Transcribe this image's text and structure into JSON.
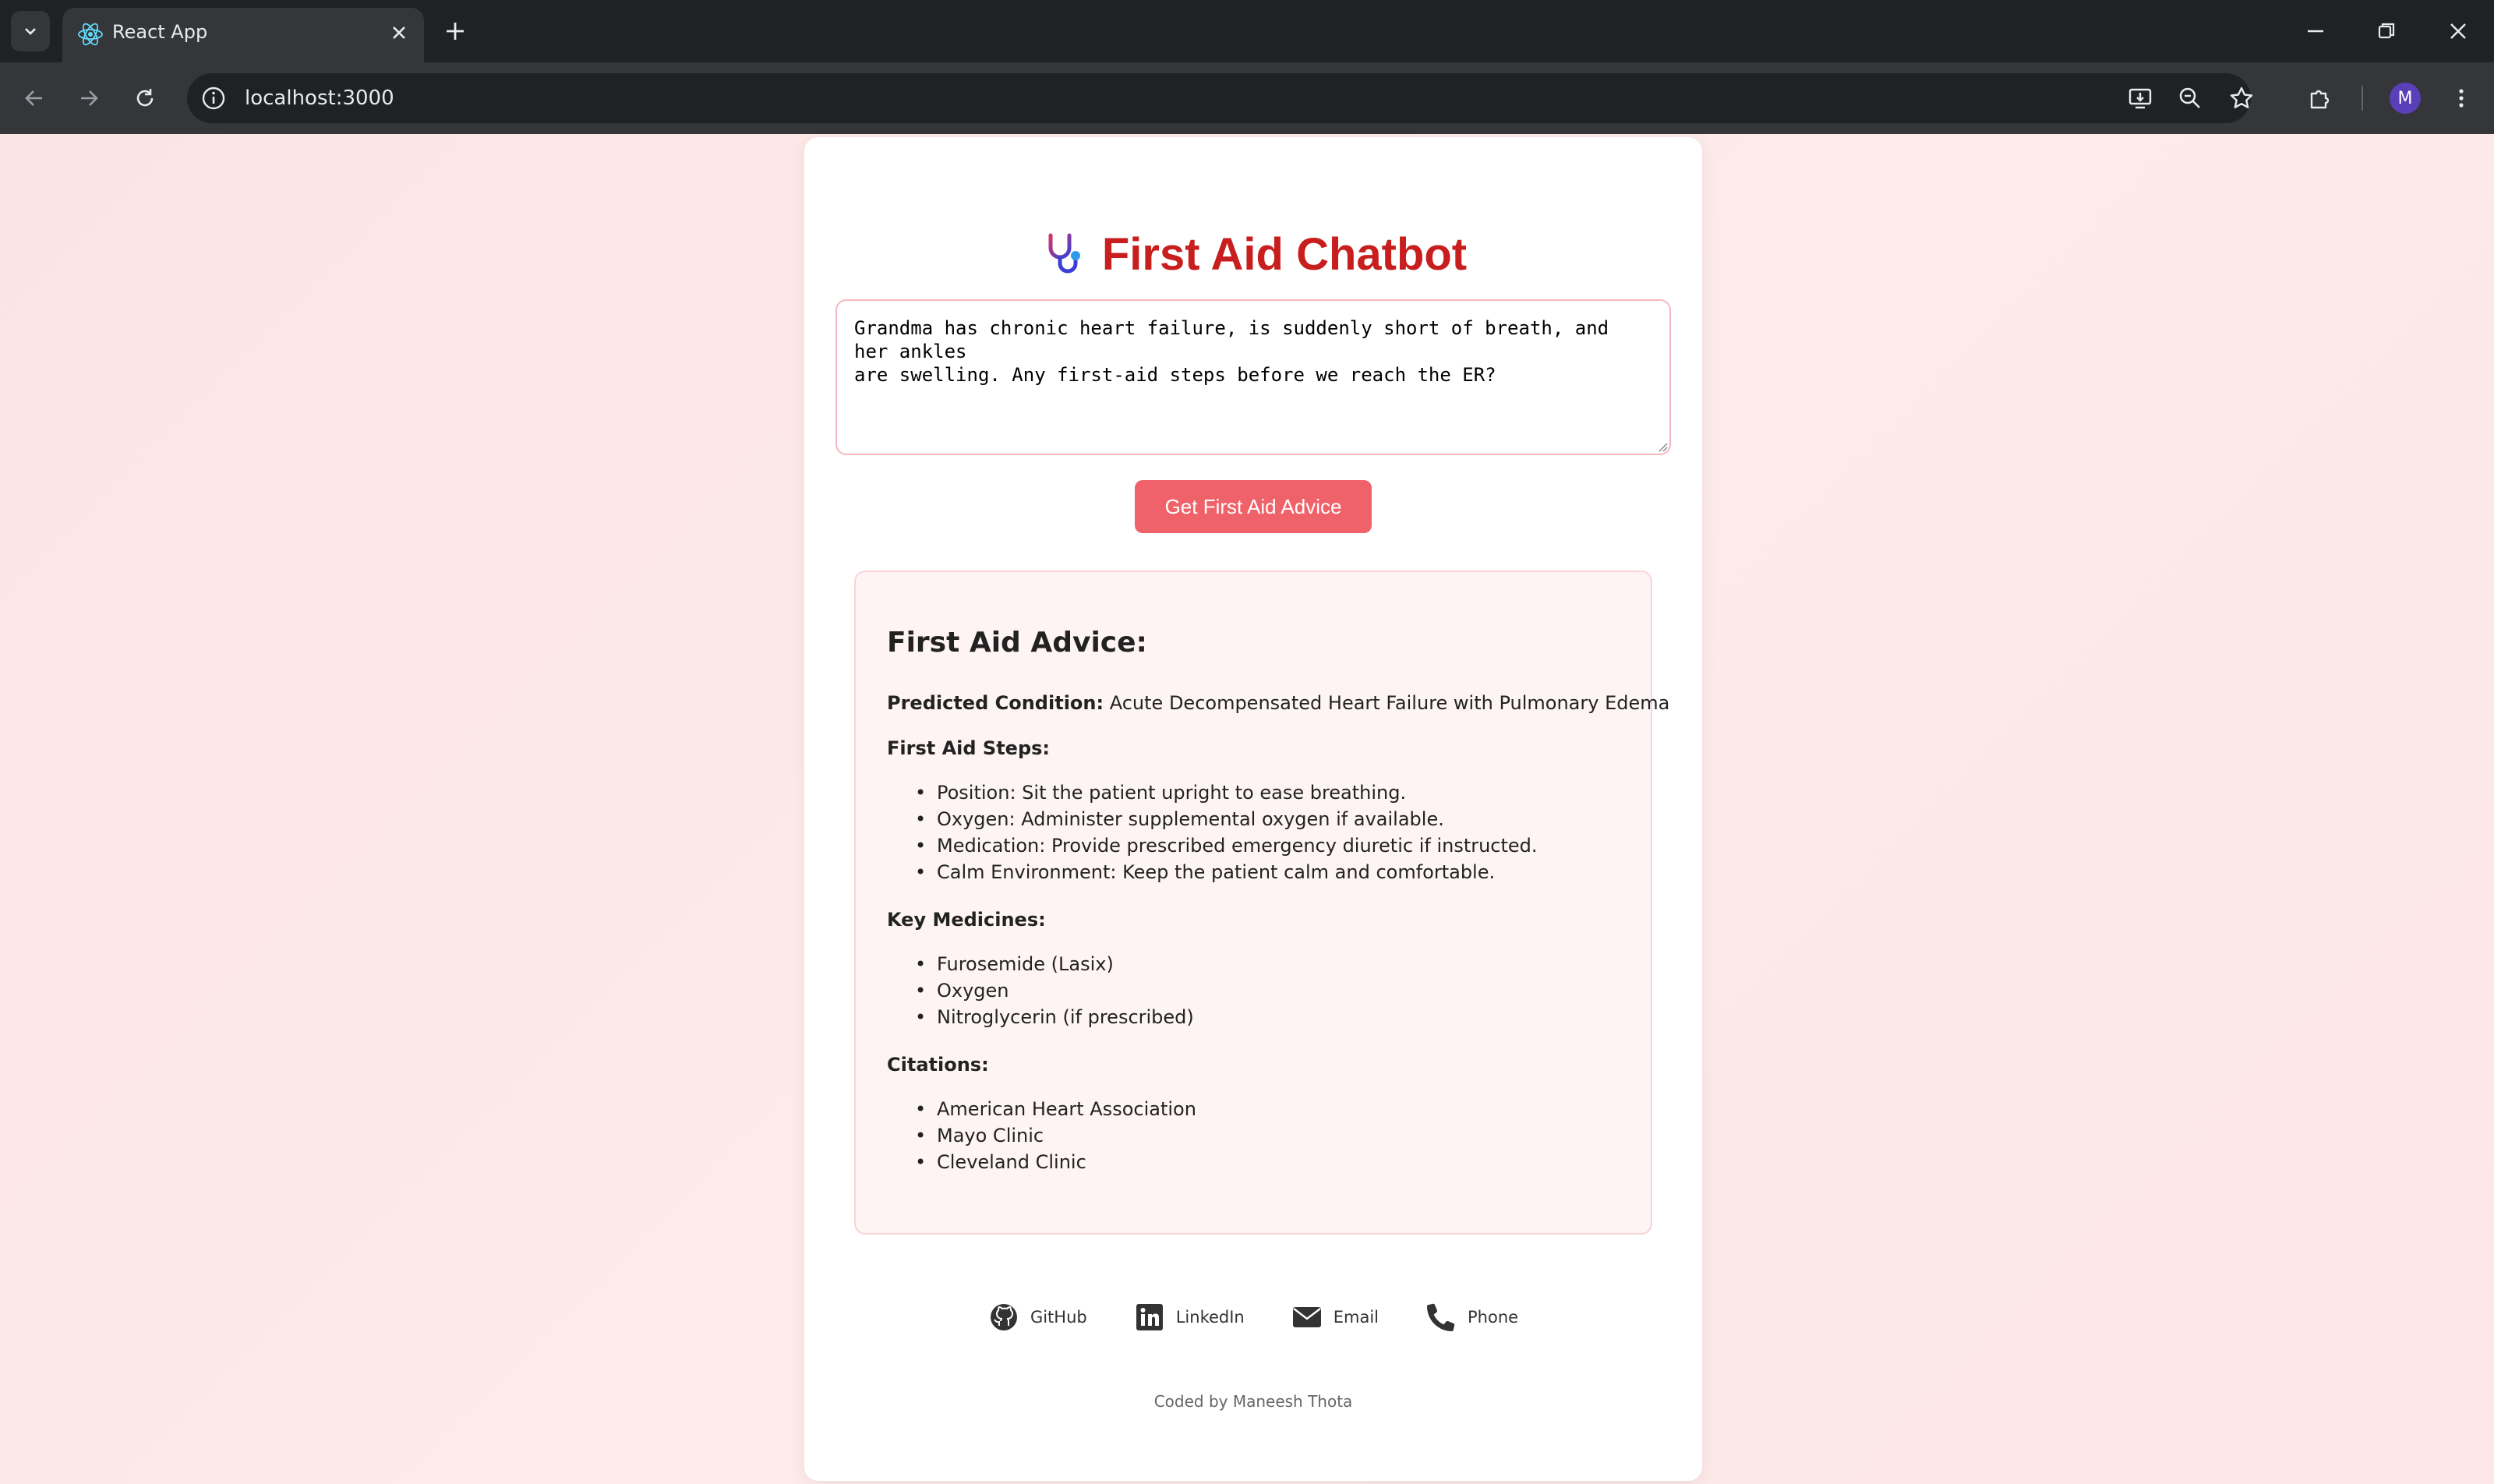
{
  "browser": {
    "tab_title": "React App",
    "url": "localhost:3000",
    "profile_initial": "M"
  },
  "app": {
    "title": "First Aid Chatbot",
    "query_text": "Grandma has chronic heart failure, is suddenly short of breath, and her ankles\nare swelling. Any first-aid steps before we reach the ER?",
    "submit_label": "Get First Aid Advice"
  },
  "advice": {
    "heading": "First Aid Advice:",
    "condition_label": "Predicted Condition:",
    "condition_value": "Acute Decompensated Heart Failure with Pulmonary Edema",
    "steps_label": "First Aid Steps:",
    "steps": [
      "Position: Sit the patient upright to ease breathing.",
      "Oxygen: Administer supplemental oxygen if available.",
      "Medication: Provide prescribed emergency diuretic if instructed.",
      "Calm Environment: Keep the patient calm and comfortable."
    ],
    "medicines_label": "Key Medicines:",
    "medicines": [
      "Furosemide (Lasix)",
      "Oxygen",
      "Nitroglycerin (if prescribed)"
    ],
    "citations_label": "Citations:",
    "citations": [
      "American Heart Association",
      "Mayo Clinic",
      "Cleveland Clinic"
    ]
  },
  "footer": {
    "links": [
      {
        "label": "GitHub",
        "icon": "github-icon"
      },
      {
        "label": "LinkedIn",
        "icon": "linkedin-icon"
      },
      {
        "label": "Email",
        "icon": "envelope-icon"
      },
      {
        "label": "Phone",
        "icon": "phone-icon"
      }
    ],
    "credit": "Coded by Maneesh Thota"
  },
  "colors": {
    "accent": "#c81e1e",
    "button": "#f0626a",
    "page_bg": "#fde9e9"
  }
}
